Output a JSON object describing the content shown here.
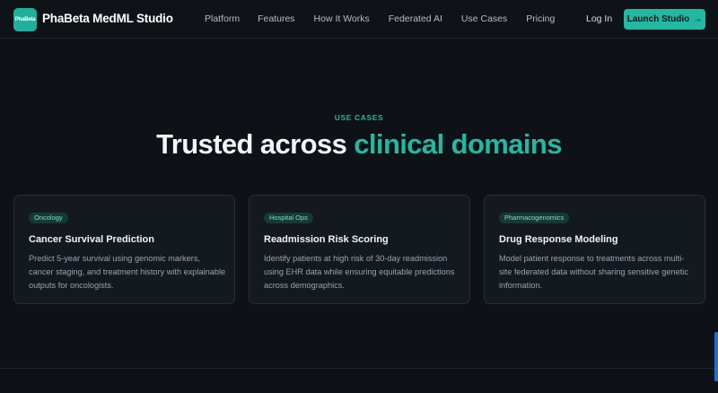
{
  "nav": {
    "logo_text": "PhaBeta",
    "brand": "PhaBeta MedML Studio",
    "links": [
      "Platform",
      "Features",
      "How It Works",
      "Federated AI",
      "Use Cases",
      "Pricing"
    ],
    "login": "Log In",
    "cta": "Launch Studio",
    "cta_icon": "→"
  },
  "hero": {
    "eyebrow": "USE CASES",
    "headline_plain": "Trusted across ",
    "headline_accent": "clinical domains"
  },
  "cards": [
    {
      "badge": "Oncology",
      "title": "Cancer Survival Prediction",
      "description": "Predict 5-year survival using genomic markers, cancer staging, and treatment history with explainable outputs for oncologists."
    },
    {
      "badge": "Hospital Ops",
      "title": "Readmission Risk Scoring",
      "description": "Identify patients at high risk of 30-day readmission using EHR data while ensuring equitable predictions across demographics."
    },
    {
      "badge": "Pharmacogenomics",
      "title": "Drug Response Modeling",
      "description": "Model patient response to treatments across multi-site federated data without sharing sensitive genetic information."
    }
  ],
  "colors": {
    "background": "#0e1116",
    "accent": "#22b8a2",
    "card": "#141920",
    "badge_bg": "#163a33"
  }
}
